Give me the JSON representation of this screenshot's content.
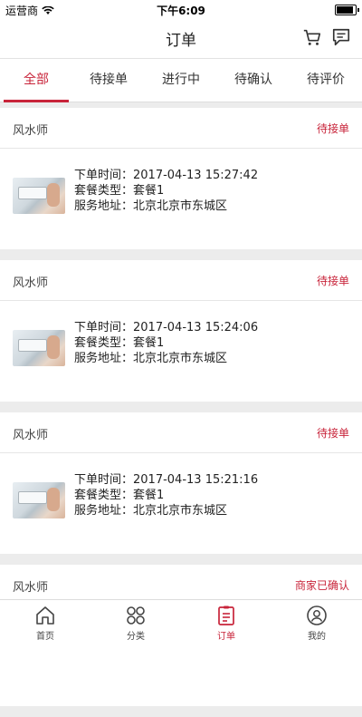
{
  "status_bar": {
    "carrier": "运营商",
    "time": "下午6:09",
    "battery_level": 0.9
  },
  "nav": {
    "title": "订单",
    "cart_icon": "cart-icon",
    "message_icon": "message-icon"
  },
  "tabs": [
    {
      "label": "全部",
      "active": true
    },
    {
      "label": "待接单"
    },
    {
      "label": "进行中"
    },
    {
      "label": "待确认"
    },
    {
      "label": "待评价"
    }
  ],
  "orders": [
    {
      "name": "风水师",
      "status": "待接单",
      "time_label": "下单时间：",
      "time": "2017-04-13 15:27:42",
      "package_label": "套餐类型：",
      "package": "套餐1",
      "address_label": "服务地址：",
      "address": "北京北京市东城区"
    },
    {
      "name": "风水师",
      "status": "待接单",
      "time_label": "下单时间：",
      "time": "2017-04-13 15:24:06",
      "package_label": "套餐类型：",
      "package": "套餐1",
      "address_label": "服务地址：",
      "address": "北京北京市东城区"
    },
    {
      "name": "风水师",
      "status": "待接单",
      "time_label": "下单时间：",
      "time": "2017-04-13 15:21:16",
      "package_label": "套餐类型：",
      "package": "套餐1",
      "address_label": "服务地址：",
      "address": "北京北京市东城区"
    },
    {
      "name": "风水师",
      "status": "商家已确认"
    }
  ],
  "tabbar": [
    {
      "label": "首页",
      "icon": "home-icon"
    },
    {
      "label": "分类",
      "icon": "category-icon"
    },
    {
      "label": "订单",
      "icon": "order-icon",
      "active": true
    },
    {
      "label": "我的",
      "icon": "profile-icon"
    }
  ],
  "colors": {
    "accent": "#c8243a",
    "background": "#ececec"
  }
}
